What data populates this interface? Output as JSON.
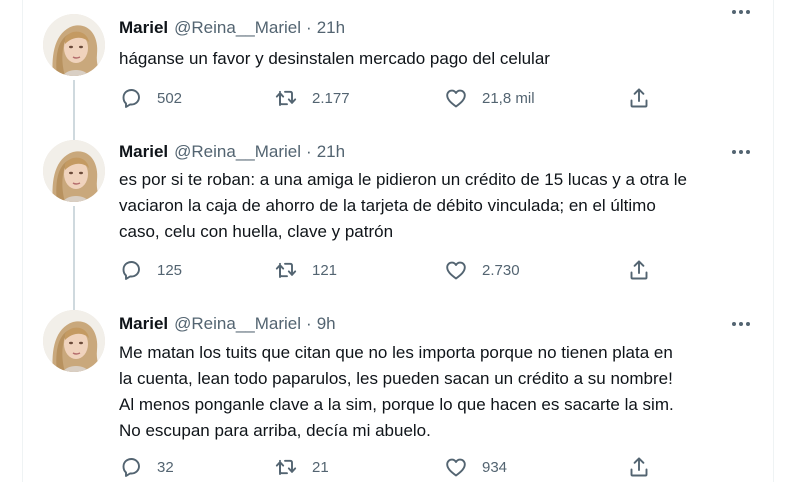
{
  "tweets": [
    {
      "name": "Mariel",
      "handle": "@Reina__Mariel",
      "separator": "·",
      "time": "21h",
      "text": "háganse un favor y desinstalen mercado pago del celular",
      "replies": "502",
      "retweets": "2.177",
      "likes": "21,8 mil"
    },
    {
      "name": "Mariel",
      "handle": "@Reina__Mariel",
      "separator": "·",
      "time": "21h",
      "text": "es por si te roban: a una amiga le pidieron un crédito de 15 lucas y a otra le\nvaciaron la caja de ahorro de la tarjeta de débito vinculada; en el último\ncaso, celu con huella, clave y patrón",
      "replies": "125",
      "retweets": "121",
      "likes": "2.730"
    },
    {
      "name": "Mariel",
      "handle": "@Reina__Mariel",
      "separator": "·",
      "time": "9h",
      "text": "Me matan los tuits que citan que no les importa porque no tienen plata en\nla cuenta, lean todo paparulos, les pueden sacan un crédito a su nombre!\nAl menos ponganle clave a la sim, porque lo que hacen es sacarte la sim.\nNo escupan para arriba, decía mi abuelo.",
      "replies": "32",
      "retweets": "21",
      "likes": "934"
    }
  ],
  "icons": {
    "more": "more-horizontal-icon",
    "reply": "reply-icon",
    "retweet": "retweet-icon",
    "like": "heart-icon",
    "share": "share-icon"
  },
  "colors": {
    "text_primary": "#0f1419",
    "text_secondary": "#536471",
    "thread_line": "#cfd9de"
  }
}
